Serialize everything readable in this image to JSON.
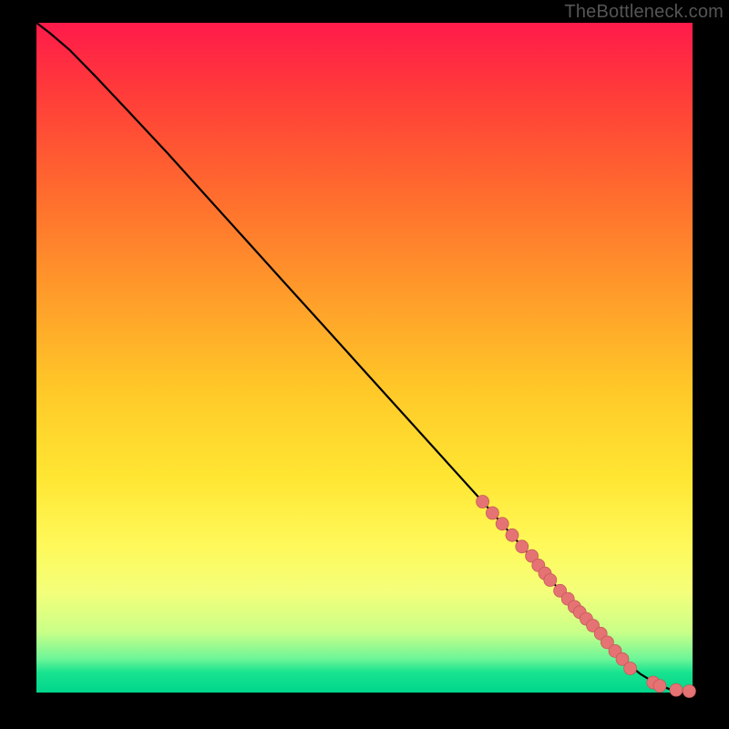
{
  "watermark": "TheBottleneck.com",
  "chart_data": {
    "type": "line",
    "title": "",
    "xlabel": "",
    "ylabel": "",
    "xlim": [
      0,
      1
    ],
    "ylim": [
      0,
      1
    ],
    "grid": false,
    "legend": false,
    "gradient_stops": [
      {
        "pos": 0.0,
        "color": "#ff1a4b"
      },
      {
        "pos": 0.1,
        "color": "#ff3a3a"
      },
      {
        "pos": 0.25,
        "color": "#ff6a2e"
      },
      {
        "pos": 0.4,
        "color": "#ff9a2a"
      },
      {
        "pos": 0.55,
        "color": "#ffc928"
      },
      {
        "pos": 0.68,
        "color": "#ffe633"
      },
      {
        "pos": 0.78,
        "color": "#fff95a"
      },
      {
        "pos": 0.85,
        "color": "#f4ff7a"
      },
      {
        "pos": 0.91,
        "color": "#c9ff88"
      },
      {
        "pos": 0.95,
        "color": "#6cf598"
      },
      {
        "pos": 0.97,
        "color": "#18e38f"
      },
      {
        "pos": 1.0,
        "color": "#00d68c"
      }
    ],
    "curve": {
      "x": [
        0.0,
        0.02,
        0.05,
        0.09,
        0.14,
        0.2,
        0.26,
        0.32,
        0.38,
        0.44,
        0.5,
        0.56,
        0.62,
        0.68,
        0.74,
        0.8,
        0.84,
        0.87,
        0.895,
        0.92,
        0.945,
        0.965,
        0.985,
        1.0
      ],
      "y": [
        1.0,
        0.985,
        0.96,
        0.92,
        0.868,
        0.805,
        0.74,
        0.675,
        0.61,
        0.545,
        0.48,
        0.415,
        0.35,
        0.285,
        0.218,
        0.15,
        0.108,
        0.075,
        0.048,
        0.028,
        0.013,
        0.005,
        0.002,
        0.002
      ]
    },
    "markers": {
      "x": [
        0.68,
        0.695,
        0.71,
        0.725,
        0.74,
        0.755,
        0.765,
        0.775,
        0.783,
        0.798,
        0.81,
        0.82,
        0.828,
        0.838,
        0.848,
        0.86,
        0.87,
        0.882,
        0.893,
        0.905,
        0.94,
        0.95,
        0.975,
        0.995
      ],
      "y": [
        0.285,
        0.268,
        0.252,
        0.235,
        0.218,
        0.204,
        0.19,
        0.178,
        0.168,
        0.152,
        0.14,
        0.128,
        0.12,
        0.11,
        0.1,
        0.088,
        0.075,
        0.062,
        0.05,
        0.036,
        0.015,
        0.01,
        0.004,
        0.002
      ],
      "radius": 7,
      "color": "#e57373"
    }
  }
}
